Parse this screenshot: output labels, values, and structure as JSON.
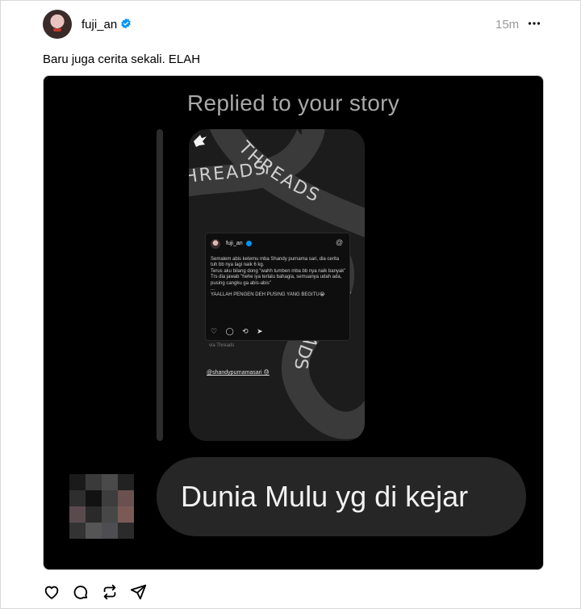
{
  "post": {
    "username": "fuji_an",
    "timestamp": "15m",
    "text": "Baru juga cerita sekali. ELAH"
  },
  "media": {
    "header": "Replied to your story",
    "threads_ribbon_text": "THREADS",
    "embedded_card": {
      "username": "fuji_an",
      "at_icon": "@",
      "body": "Semalem abis ketemu mba Shandy purnama sari, dia cerita tuh bb nya lagi naik 6 kg.\nTerus aku bilang dong \"wahh tumben mba bb nya naik banyak\"\nTrs dia jawab \"hehe iya terlalu bahagia, semuanya udah ada, pusing cangku ga abis-abis\"\n...\nYAALLAH PENGEN DEH PUSING YANG BEGITU😭",
      "icons": "♡ ◯ ⟲ ➤"
    },
    "via_text": "via Threads",
    "mention": "@shandypurnamasari",
    "mention_emoji": "😓",
    "reply_text": "Dunia Mulu yg di kejar"
  },
  "icons": {
    "verified": "verified-badge-icon",
    "more": "more-icon",
    "like": "heart-icon",
    "comment": "comment-icon",
    "repost": "repost-icon",
    "share": "share-icon"
  },
  "colors": {
    "verified": "#0095f6",
    "timestamp": "#999999",
    "media_bg": "#000000",
    "bubble": "#262626"
  }
}
